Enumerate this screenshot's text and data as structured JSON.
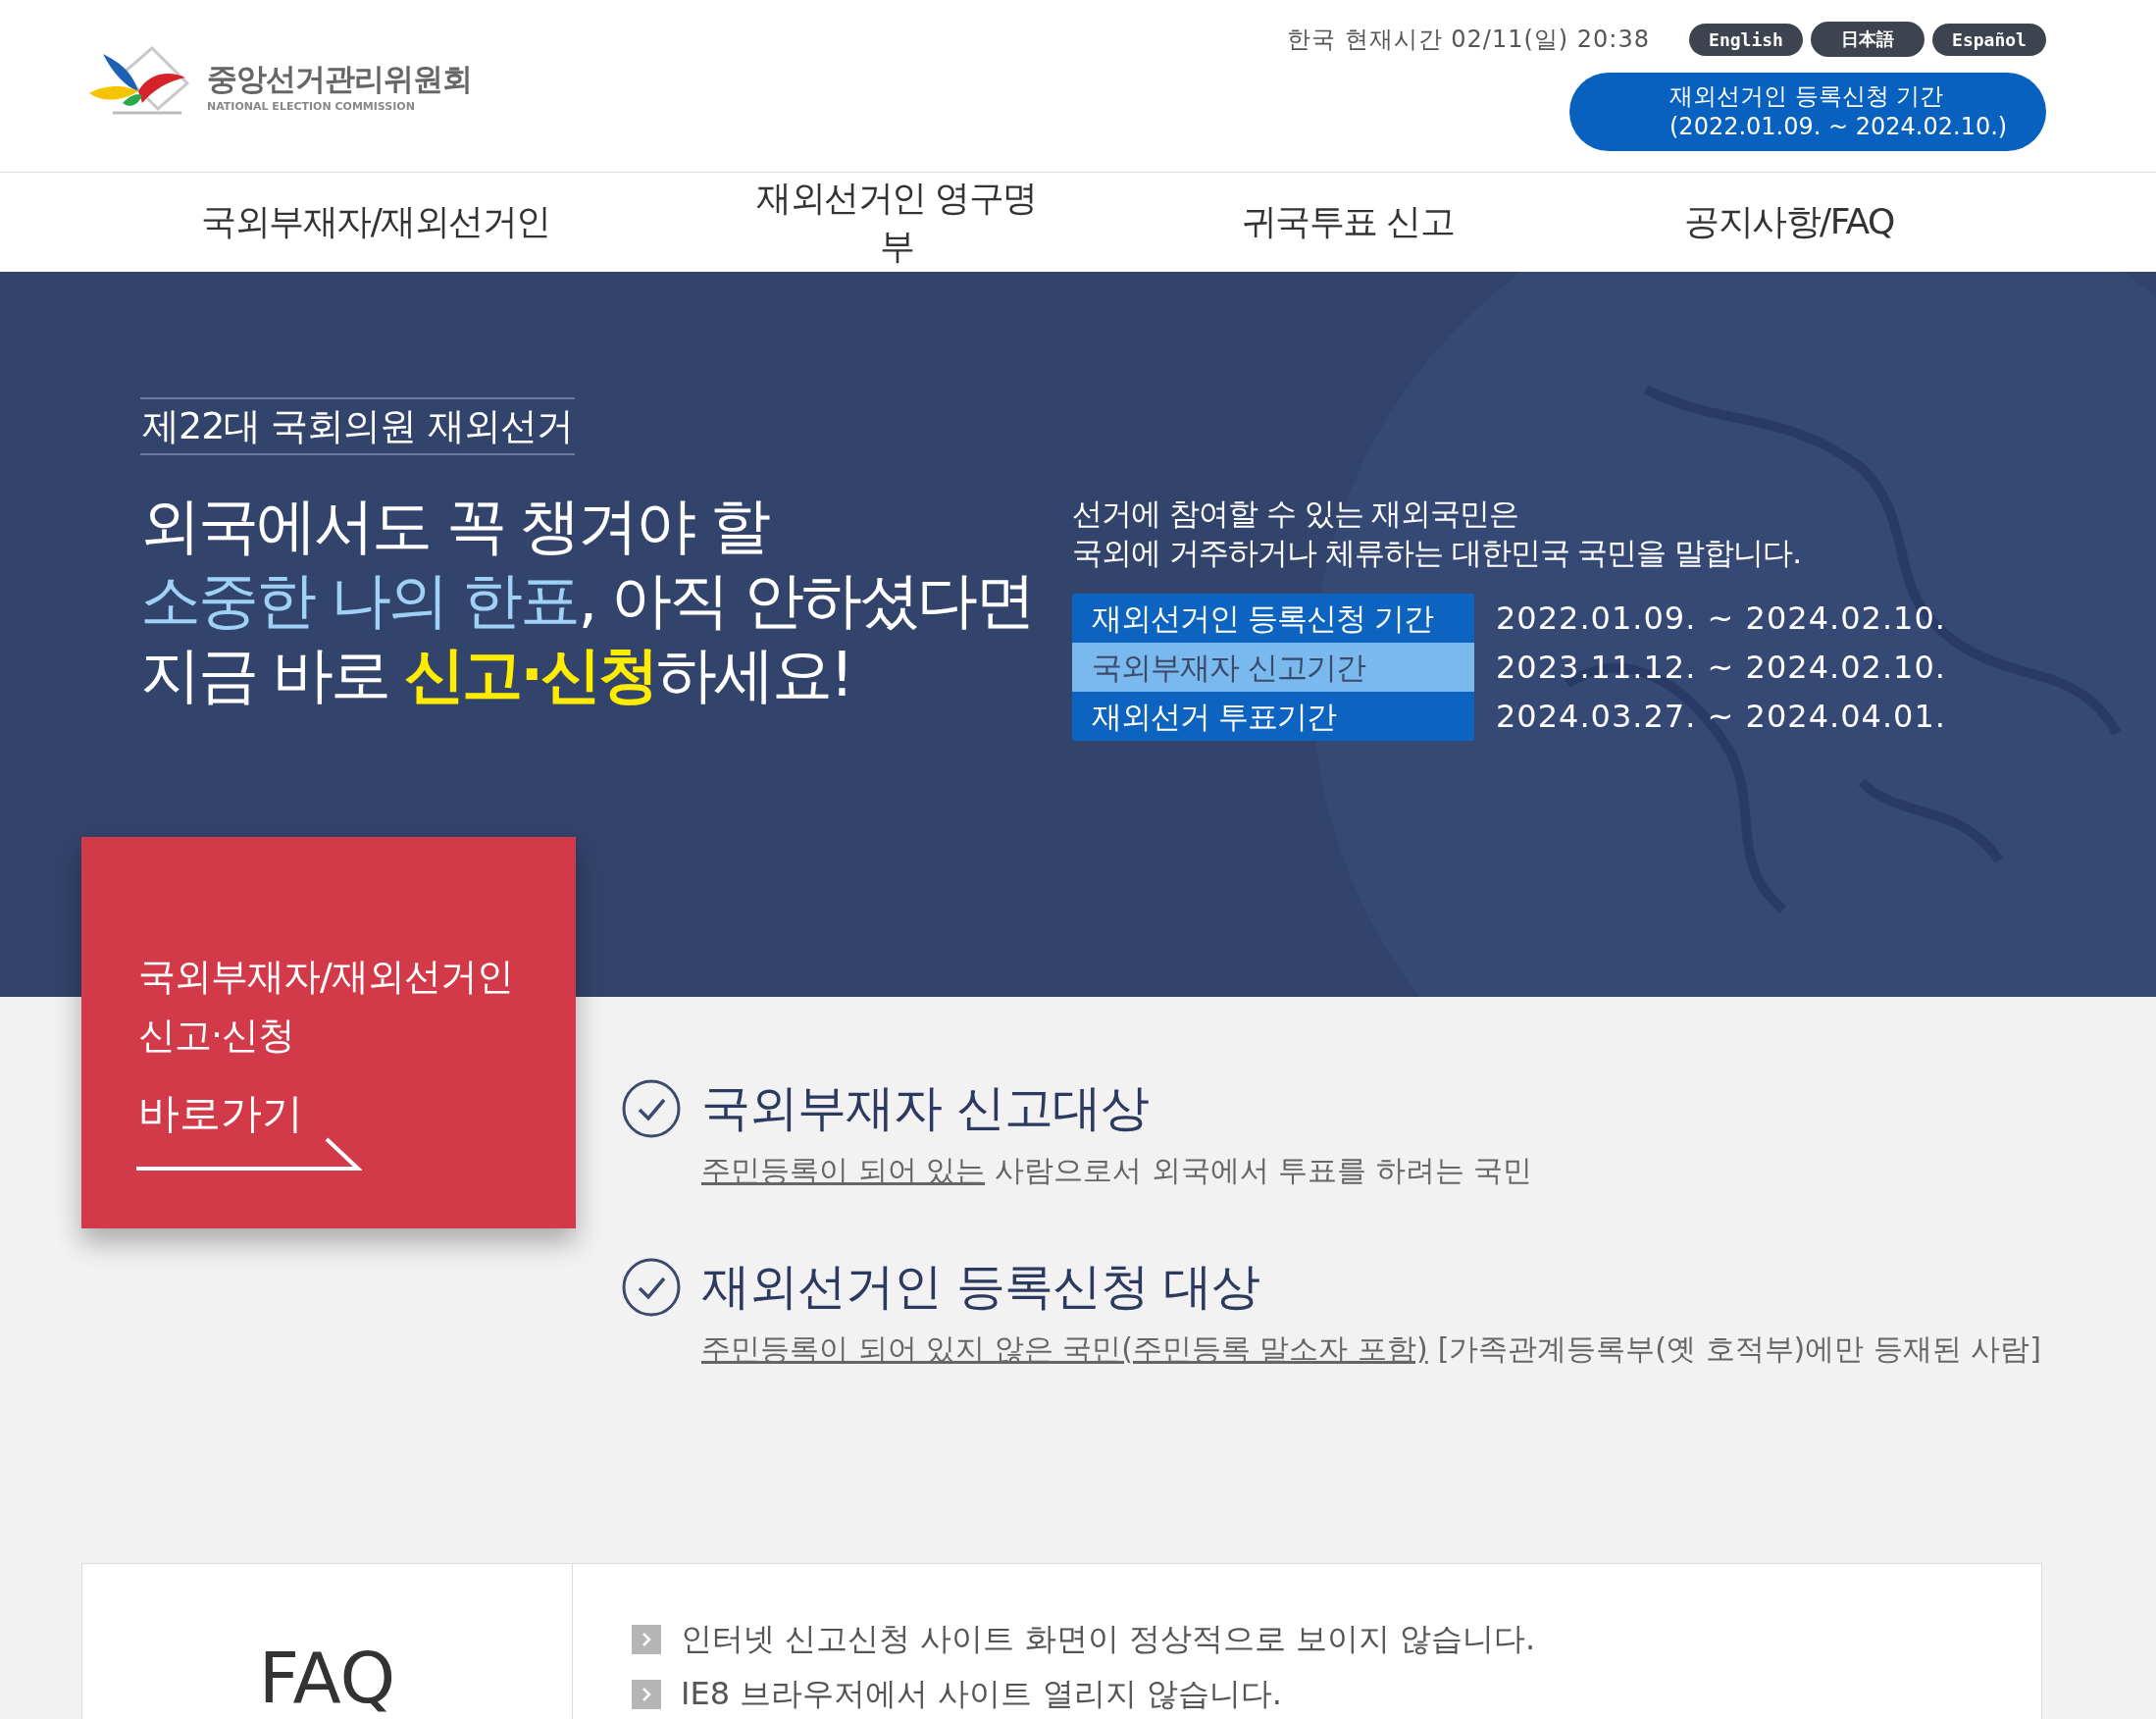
{
  "header": {
    "logo": {
      "name": "중앙선거관리위원회",
      "subtitle": "NATIONAL ELECTION COMMISSION"
    },
    "clock": "한국 현재시간 02/11(일) 20:38",
    "languages": [
      "English",
      "日本語",
      "Español"
    ],
    "registration_pill": {
      "line1": "재외선거인 등록신청 기간",
      "line2": "(2022.01.09. ~ 2024.02.10.)"
    }
  },
  "nav": [
    "국외부재자/재외선거인",
    "재외선거인 영구명부",
    "귀국투표 신고",
    "공지사항/FAQ"
  ],
  "hero": {
    "subtitle": "제22대 국회의원 재외선거",
    "headline": [
      [
        {
          "kind": "plain",
          "text": "외국에서도 꼭 챙겨야 할"
        }
      ],
      [
        {
          "kind": "light",
          "text": "소중한 나의 한표"
        },
        {
          "kind": "plain",
          "text": ", 아직 안하셨다면"
        }
      ],
      [
        {
          "kind": "plain",
          "text": "지금 바로 "
        },
        {
          "kind": "accent",
          "text": "신고·신청"
        },
        {
          "kind": "plain",
          "text": "하세요!"
        }
      ]
    ],
    "intro": [
      "선거에 참여할 수 있는 재외국민은",
      "국외에 거주하거나 체류하는 대한민국 국민을 말합니다."
    ],
    "periods": [
      {
        "label": "재외선거인 등록신청 기간",
        "dates": "2022.01.09. ~ 2024.02.10.",
        "selected": false
      },
      {
        "label": "국외부재자 신고기간",
        "dates": "2023.11.12. ~ 2024.02.10.",
        "selected": true
      },
      {
        "label": "재외선거 투표기간",
        "dates": "2024.03.27. ~ 2024.04.01.",
        "selected": false
      }
    ]
  },
  "apply_card": {
    "title_lines": [
      "국외부재자/재외선거인",
      "신고·신청"
    ],
    "link": "바로가기"
  },
  "targets": [
    {
      "title": "국외부재자 신고대상",
      "link": "주민등록이 되어 있는",
      "text": "사람으로서 외국에서 투표를 하려는 국민"
    },
    {
      "title": "재외선거인 등록신청 대상",
      "link": "주민등록이 되어 있지 않은 국민(주민등록 말소자 포함)",
      "text": "[가족관계등록부(옛 호적부)에만 등재된 사람]"
    }
  ],
  "faq": {
    "title": "FAQ",
    "items": [
      "인터넷 신고신청 사이트 화면이 정상적으로 보이지 않습니다.",
      "IE8 브라우저에서 사이트 열리지 않습니다."
    ]
  }
}
